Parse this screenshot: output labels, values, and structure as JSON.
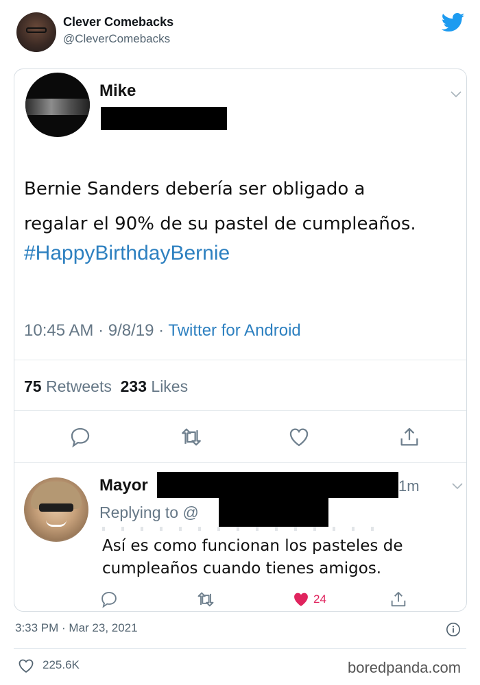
{
  "embed": {
    "author_name": "Clever Comebacks",
    "author_handle": "@CleverComebacks",
    "footer_time": "3:33 PM · Mar 23, 2021",
    "footer_likes": "225.6K",
    "watermark": "boredpanda.com"
  },
  "screenshot": {
    "tweet": {
      "name": "Mike",
      "text_line1": "Bernie Sanders debería ser obligado a",
      "text_line2": "regalar el 90% de su pastel de cumpleaños.",
      "hashtag": "#HappyBirthdayBernie",
      "time_date": "10:45 AM · 9/8/19 · ",
      "source": "Twitter for Android",
      "retweets_count": "75",
      "retweets_label": "Retweets",
      "likes_count": "233",
      "likes_label": "Likes"
    },
    "reply": {
      "name": "Mayor",
      "time": "1m",
      "replying_to": "Replying to @",
      "text_line1": "Así es como funcionan los pasteles de",
      "text_line2": "cumpleaños cuando tienes amigos.",
      "like_count": "24"
    }
  },
  "colors": {
    "twitter_blue": "#1d9bf0",
    "link_blue": "#2d80c0",
    "like_red": "#e0245e"
  },
  "icons": [
    "twitter-bird-icon",
    "reply-icon",
    "retweet-icon",
    "heart-icon",
    "share-icon",
    "info-icon",
    "chevron-down-icon"
  ]
}
